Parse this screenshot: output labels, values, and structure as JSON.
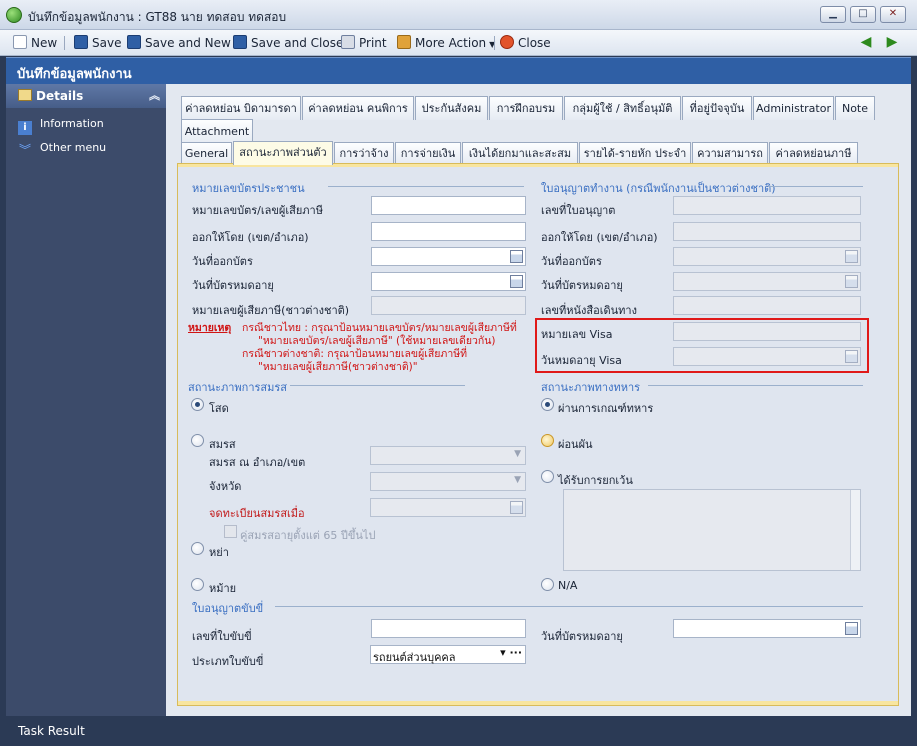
{
  "window": {
    "title": "บันทึกข้อมูลพนักงาน : GT88 นาย ทดสอบ ทดสอบ"
  },
  "toolbar": {
    "new": "New",
    "save": "Save",
    "save_new": "Save and New",
    "save_close": "Save and Close",
    "print": "Print",
    "more_action": "More Action",
    "close": "Close"
  },
  "header": {
    "title": "บันทึกข้อมูลพนักงาน"
  },
  "sidebar": {
    "head": "Details",
    "items": [
      {
        "label": "Information"
      },
      {
        "label": "Other menu"
      }
    ]
  },
  "tabs_row1": [
    "ค่าลดหย่อน บิดามารดา",
    "ค่าลดหย่อน คนพิการ",
    "ประกันสังคม",
    "การฝึกอบรม",
    "กลุ่มผู้ใช้ / สิทธิ์อนุมัติ",
    "ที่อยู่ปัจจุบัน",
    "Administrator",
    "Note"
  ],
  "tabs_row2": [
    "Attachment"
  ],
  "tabs_row3": [
    "General",
    "สถานะภาพส่วนตัว",
    "การว่าจ้าง",
    "การจ่ายเงิน",
    "เงินได้ยกมาและสะสม",
    "รายได้-รายหัก ประจำ",
    "ความสามารถ",
    "ค่าลดหย่อนภาษี"
  ],
  "id_card": {
    "section": "หมายเลขบัตรประชาชน",
    "card_no": "หมายเลขบัตร/เลขผู้เสียภาษี",
    "issued_by": "ออกให้โดย (เขต/อำเภอ)",
    "issue_date": "วันที่ออกบัตร",
    "expiry_date": "วันที่บัตรหมดอายุ",
    "foreign_tax_id": "หมายเลขผู้เสียภาษี(ชาวต่างชาติ)"
  },
  "remark": {
    "title": "หมายเหตุ",
    "line1": "กรณีชาวไทย : กรุณาป้อนหมายเลขบัตร/หมายเลขผู้เสียภาษีที่",
    "line2": "\"หมายเลขบัตร/เลขผู้เสียภาษี\" (ใช้หมายเลขเดียวกัน)",
    "line3": "กรณีชาวต่างชาติ: กรุณาป้อนหมายเลขผู้เสียภาษีที่",
    "line4": "\"หมายเลขผู้เสียภาษี(ชาวต่างชาติ)\""
  },
  "work_permit": {
    "section": "ใบอนุญาตทำงาน (กรณีพนักงานเป็นชาวต่างชาติ)",
    "permit_no": "เลขที่ใบอนุญาต",
    "issued_by": "ออกให้โดย (เขต/อำเภอ)",
    "issue_date": "วันที่ออกบัตร",
    "expiry_date": "วันที่บัตรหมดอายุ",
    "passport_no": "เลขที่หนังสือเดินทาง",
    "visa_no": "หมายเลข Visa",
    "visa_expiry": "วันหมดอายุ Visa"
  },
  "marital": {
    "section": "สถานะภาพการสมรส",
    "single": "โสด",
    "married": "สมรส",
    "married_at": "สมรส ณ อำเภอ/เขต",
    "province": "จังหวัด",
    "registered": "จดทะเบียนสมรสเมื่อ",
    "spouse_65": "คู่สมรสอายุตั้งแต่ 65 ปีขึ้นไป",
    "divorced": "หย่า",
    "widowed": "หม้าย"
  },
  "military": {
    "section": "สถานะภาพทางทหาร",
    "passed": "ผ่านการเกณฑ์ทหาร",
    "deferred": "ผ่อนผัน",
    "exempted": "ได้รับการยกเว้น",
    "na": "N/A"
  },
  "license": {
    "section": "ใบอนุญาตขับขี่",
    "license_no": "เลขที่ใบขับขี่",
    "expiry_date": "วันที่บัตรหมดอายุ",
    "type": "ประเภทใบขับขี่",
    "type_value": "รถยนต์ส่วนบุคคล"
  },
  "status": {
    "text": "Task Result"
  }
}
